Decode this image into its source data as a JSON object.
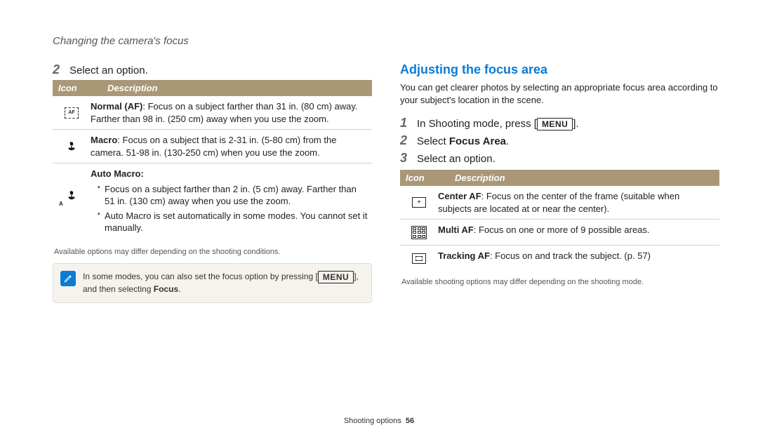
{
  "page_title": "Changing the camera's focus",
  "left": {
    "step2_num": "2",
    "step2_text": "Select an option.",
    "table": {
      "h_icon": "Icon",
      "h_desc": "Description",
      "r1_bold": "Normal (AF)",
      "r1_rest": ": Focus on a subject farther than 31 in. (80 cm) away. Farther than 98 in. (250 cm) away when you use the zoom.",
      "r2_bold": "Macro",
      "r2_rest": ": Focus on a subject that is 2-31 in. (5-80 cm) from the camera. 51-98 in. (130-250 cm) when you use the zoom.",
      "r3_title": "Auto Macro:",
      "r3_b1": "Focus on a subject farther than 2 in. (5 cm) away. Farther than 51 in. (130 cm) away when you use the zoom.",
      "r3_b2": "Auto Macro is set automatically in some modes. You cannot set it manually."
    },
    "footnote": "Available options may differ depending on the shooting conditions.",
    "note_before": "In some modes, you can also set the focus option by pressing [",
    "note_menu": "MENU",
    "note_after": "], and then selecting ",
    "note_bold": "Focus",
    "note_end": "."
  },
  "right": {
    "heading": "Adjusting the focus area",
    "intro": "You can get clearer photos by selecting an appropriate focus area according to your subject's location in the scene.",
    "step1_num": "1",
    "step1_before": "In Shooting mode, press [",
    "step1_menu": "MENU",
    "step1_after": "].",
    "step2_num": "2",
    "step2_before": "Select ",
    "step2_bold": "Focus Area",
    "step2_after": ".",
    "step3_num": "3",
    "step3_text": "Select an option.",
    "table": {
      "h_icon": "Icon",
      "h_desc": "Description",
      "r1_bold": "Center AF",
      "r1_rest": ": Focus on the center of the frame (suitable when subjects are located at or near the center).",
      "r2_bold": "Multi AF",
      "r2_rest": ": Focus on one or more of 9 possible areas.",
      "r3_bold": "Tracking AF",
      "r3_rest": ": Focus on and track the subject. (p. 57)"
    },
    "footnote": "Available shooting options may differ depending on the shooting mode."
  },
  "footer_section": "Shooting options",
  "footer_page": "56"
}
